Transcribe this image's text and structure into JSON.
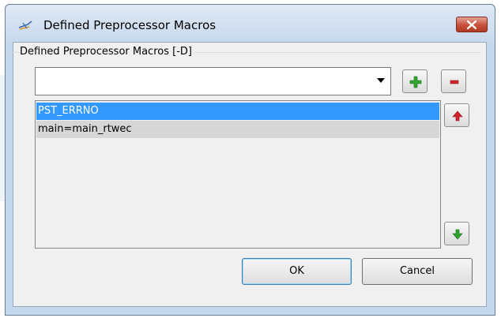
{
  "dialog": {
    "title": "Defined Preprocessor Macros",
    "group_label": "Defined Preprocessor Macros [-D]"
  },
  "combo": {
    "value": ""
  },
  "macros": [
    {
      "label": "PST_ERRNO",
      "selected": true
    },
    {
      "label": "main=main_rtwec",
      "selected": false
    }
  ],
  "buttons": {
    "ok_label": "OK",
    "cancel_label": "Cancel",
    "add_icon": "plus-icon",
    "remove_icon": "minus-icon",
    "move_up_icon": "arrow-up-icon",
    "move_down_icon": "arrow-down-icon"
  },
  "colors": {
    "selection": "#3399ff",
    "unselected_row": "#d6d6d6",
    "plus": "#2fa52f",
    "minus": "#d2232a",
    "close": "#c7503a"
  }
}
